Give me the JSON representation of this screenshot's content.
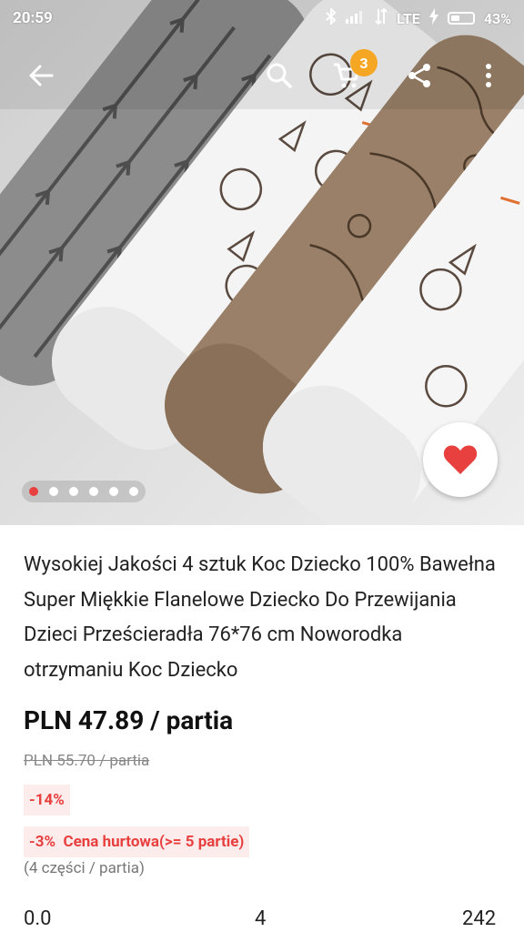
{
  "status_bar": {
    "time": "20:59",
    "network": "LTE",
    "battery": "43%",
    "battery_level": 0.43
  },
  "toolbar": {
    "cart_count": "3",
    "icons": [
      "back-arrow-icon",
      "search-icon",
      "cart-icon",
      "share-icon",
      "more-vert-icon"
    ]
  },
  "carousel": {
    "total": 6,
    "active_index": 0
  },
  "colors": {
    "accent": "#e8403f",
    "badge_orange": "#f5a623",
    "discount_bg": "#fdecec"
  },
  "product": {
    "title": "Wysokiej Jakości 4 sztuk Koc Dziecko 100% Bawełna Super Miękkie Flanelowe Dziecko Do Przewijania Dzieci Prześcieradła 76*76 cm Noworodka otrzymaniu Koc Dziecko",
    "price": "PLN 47.89 / partia",
    "old_price": "PLN 55.70 / partia",
    "discount": "-14%",
    "wholesale": "-3%  Cena hurtowa(>= 5 partie)",
    "pieces": "(4 części / partia)"
  },
  "stats": {
    "rating": "0.0",
    "reviews": "4",
    "orders": "242"
  }
}
